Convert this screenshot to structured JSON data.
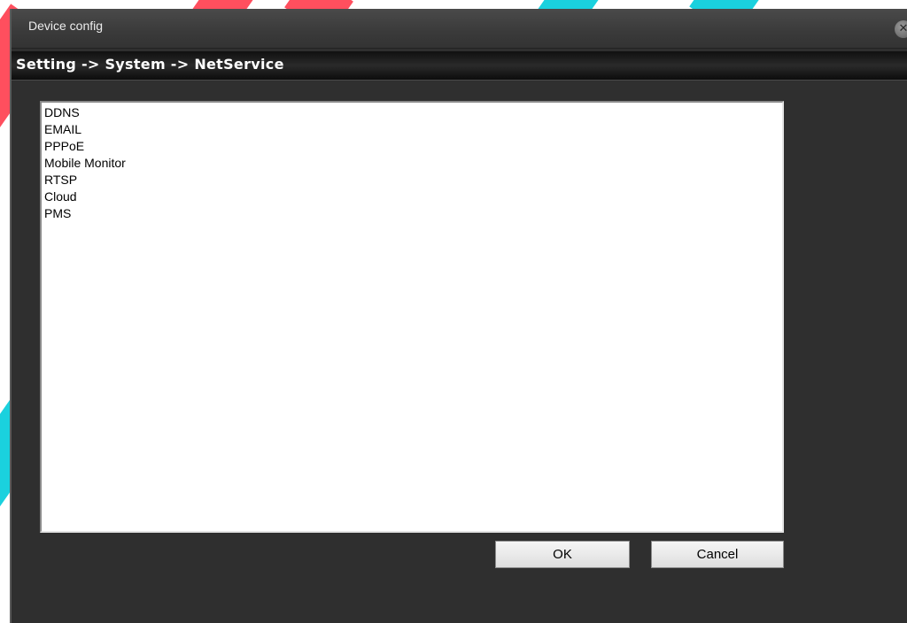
{
  "window": {
    "title": "Device config",
    "close_symbol": "✕"
  },
  "breadcrumb": {
    "text": "Setting -> System -> NetService"
  },
  "services": {
    "items": [
      "DDNS",
      "EMAIL",
      "PPPoE",
      "Mobile Monitor",
      "RTSP",
      "Cloud",
      "PMS"
    ]
  },
  "buttons": {
    "ok_label": "OK",
    "cancel_label": "Cancel"
  },
  "colors": {
    "window_bg": "#2f2f2f",
    "list_bg": "#ffffff",
    "accent_red": "#ff4f5e",
    "accent_cyan": "#1ad1de"
  },
  "icons": {
    "close": "close-icon"
  }
}
